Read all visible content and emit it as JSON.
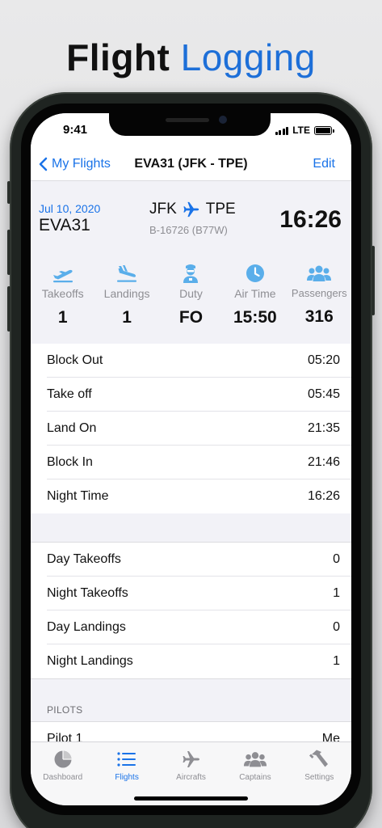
{
  "headline": {
    "word1": "Flight",
    "word2": "Logging"
  },
  "statusbar": {
    "time": "9:41",
    "network": "LTE"
  },
  "navbar": {
    "back_label": "My Flights",
    "title": "EVA31 (JFK - TPE)",
    "edit_label": "Edit"
  },
  "summary": {
    "date": "Jul 10, 2020",
    "flight_number": "EVA31",
    "origin": "JFK",
    "destination": "TPE",
    "registration": "B-16726 (B77W)",
    "duration": "16:26"
  },
  "stats": [
    {
      "label": "Takeoffs",
      "value": "1",
      "icon": "takeoff-icon"
    },
    {
      "label": "Landings",
      "value": "1",
      "icon": "landing-icon"
    },
    {
      "label": "Duty",
      "value": "FO",
      "icon": "pilot-icon"
    },
    {
      "label": "Air Time",
      "value": "15:50",
      "icon": "clock-icon"
    },
    {
      "label": "Passengers",
      "value": "316",
      "icon": "passengers-icon"
    }
  ],
  "times": [
    {
      "label": "Block Out",
      "value": "05:20"
    },
    {
      "label": "Take off",
      "value": "05:45"
    },
    {
      "label": "Land On",
      "value": "21:35"
    },
    {
      "label": "Block In",
      "value": "21:46"
    },
    {
      "label": "Night Time",
      "value": "16:26"
    }
  ],
  "counts": [
    {
      "label": "Day Takeoffs",
      "value": "0"
    },
    {
      "label": "Night Takeoffs",
      "value": "1"
    },
    {
      "label": "Day Landings",
      "value": "0"
    },
    {
      "label": "Night Landings",
      "value": "1"
    }
  ],
  "pilots": {
    "header": "PILOTS",
    "rows": [
      {
        "label": "Pilot 1",
        "value": "Me"
      }
    ]
  },
  "tabs": [
    {
      "label": "Dashboard",
      "icon": "dashboard-icon",
      "active": false
    },
    {
      "label": "Flights",
      "icon": "list-icon",
      "active": true
    },
    {
      "label": "Aircrafts",
      "icon": "airplane-icon",
      "active": false
    },
    {
      "label": "Captains",
      "icon": "people-icon",
      "active": false
    },
    {
      "label": "Settings",
      "icon": "hammer-icon",
      "active": false
    }
  ],
  "colors": {
    "accent": "#1a73e8",
    "icon_blue": "#5aaeea",
    "headline_blue": "#1d6fd8"
  }
}
